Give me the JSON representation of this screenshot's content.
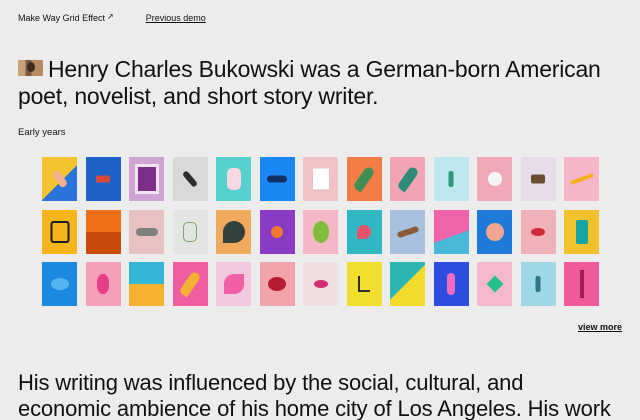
{
  "nav": {
    "site_title": "Make Way Grid Effect",
    "previous_demo": "Previous demo"
  },
  "headline": {
    "text": "Henry Charles Bukowski was a German-born American poet, novelist, and short story writer."
  },
  "section": {
    "label": "Early years"
  },
  "grid": {
    "rows": [
      [
        {
          "bg": "#f2c22f",
          "accent": "#2a73d9",
          "kind": "diag-hand"
        },
        {
          "bg": "#1d63c7",
          "accent": "#d94a3d",
          "kind": "objects"
        },
        {
          "bg": "#cfa4d5",
          "accent": "#7c2e88",
          "kind": "frame"
        },
        {
          "bg": "#d9d9d9",
          "accent": "#2d2d2d",
          "kind": "tool"
        },
        {
          "bg": "#57d1cd",
          "accent": "#f7d8e3",
          "kind": "bottle"
        },
        {
          "bg": "#1a87f2",
          "accent": "#0f2f67",
          "kind": "shoe"
        },
        {
          "bg": "#f1c2c6",
          "accent": "#ffffff",
          "kind": "card"
        },
        {
          "bg": "#f47c47",
          "accent": "#3f8f54",
          "kind": "leaf"
        },
        {
          "bg": "#f2a4b4",
          "accent": "#2f8b77",
          "kind": "palm"
        },
        {
          "bg": "#bde6ef",
          "accent": "#2d9a7c",
          "kind": "figure"
        },
        {
          "bg": "#f0a7b8",
          "accent": "#2369c8",
          "kind": "cup"
        },
        {
          "bg": "#e7ddea",
          "accent": "#6b4d34",
          "kind": "camera"
        },
        {
          "bg": "#f5b6c8",
          "accent": "#f3b21d",
          "kind": "pencil"
        }
      ],
      [
        {
          "bg": "#f4b51a",
          "accent": "#1f1f1f",
          "kind": "gameboy"
        },
        {
          "bg": "#ef6e16",
          "accent": "#c84a0a",
          "kind": "orange"
        },
        {
          "bg": "#e8c1c1",
          "accent": "#7f7f7f",
          "kind": "sneaker"
        },
        {
          "bg": "#e4e4e4",
          "accent": "#7ea06b",
          "kind": "glass"
        },
        {
          "bg": "#f0aa5d",
          "accent": "#34413a",
          "kind": "monstera"
        },
        {
          "bg": "#8a3bc5",
          "accent": "#ee7a2f",
          "kind": "purple"
        },
        {
          "bg": "#f5b7c5",
          "accent": "#7fbe3c",
          "kind": "avocado"
        },
        {
          "bg": "#2fb7c4",
          "accent": "#e7526d",
          "kind": "flamingo"
        },
        {
          "bg": "#a7c1de",
          "accent": "#8d5b38",
          "kind": "cigar"
        },
        {
          "bg": "#ef64a8",
          "accent": "#48b9d8",
          "kind": "pool"
        },
        {
          "bg": "#1e7ad8",
          "accent": "#f3a68e",
          "kind": "flower"
        },
        {
          "bg": "#f0b2b8",
          "accent": "#d0283b",
          "kind": "lips"
        },
        {
          "bg": "#f1c22d",
          "accent": "#14a6a5",
          "kind": "doorway"
        }
      ],
      [
        {
          "bg": "#1d88df",
          "accent": "#52b6ed",
          "kind": "blob"
        },
        {
          "bg": "#f4a1b8",
          "accent": "#e63d86",
          "kind": "pineapple"
        },
        {
          "bg": "#33b7d7",
          "accent": "#f6b12e",
          "kind": "stripes"
        },
        {
          "bg": "#ef5ea1",
          "accent": "#f4b233",
          "kind": "plant"
        },
        {
          "bg": "#f3c7de",
          "accent": "#f05fa6",
          "kind": "petals"
        },
        {
          "bg": "#f1a4aa",
          "accent": "#b51d32",
          "kind": "shadow"
        },
        {
          "bg": "#f1dede",
          "accent": "#d12f72",
          "kind": "mouth"
        },
        {
          "bg": "#f2df2d",
          "accent": "#2f2f2f",
          "kind": "chair"
        },
        {
          "bg": "#2cb6b1",
          "accent": "#f2db2d",
          "kind": "arch"
        },
        {
          "bg": "#2e4ee0",
          "accent": "#f66ac0",
          "kind": "bottle-pink"
        },
        {
          "bg": "#f5b8cd",
          "accent": "#29bf8d",
          "kind": "window"
        },
        {
          "bg": "#9fd7e6",
          "accent": "#2d7884",
          "kind": "cactus"
        },
        {
          "bg": "#f05a9b",
          "accent": "#a21b52",
          "kind": "tall"
        }
      ]
    ]
  },
  "links": {
    "view_more": "view more"
  },
  "body": {
    "text": "His writing was influenced by the social, cultural, and economic ambience of his home city of Los Angeles. His work"
  }
}
